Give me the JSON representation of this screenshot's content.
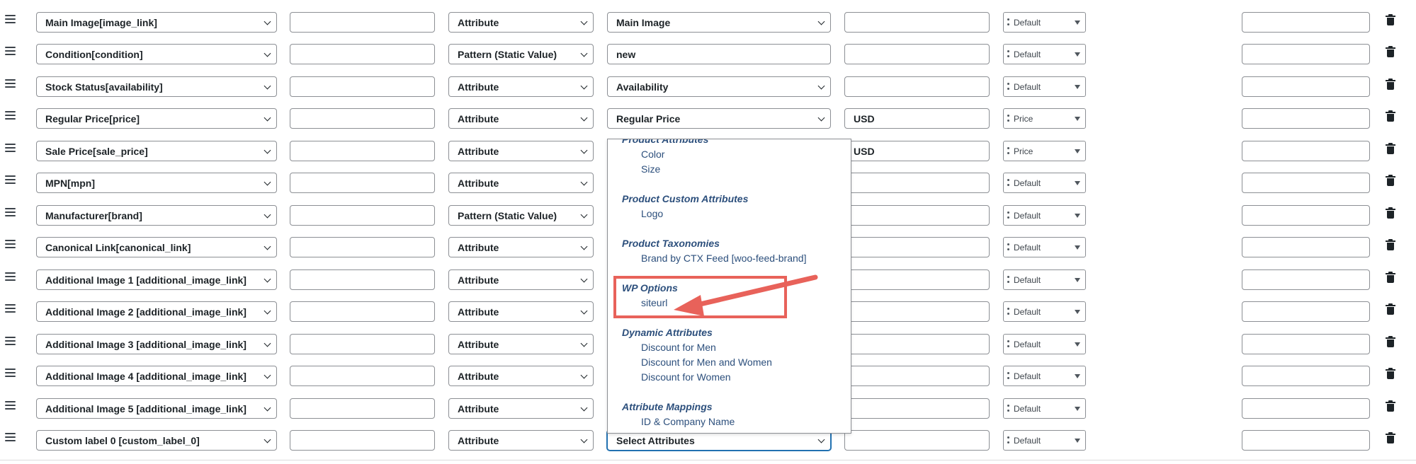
{
  "rows": [
    {
      "attribute": "Main Image[image_link]",
      "prefix": "",
      "type": "Attribute",
      "value": "Main Image",
      "suffix": "",
      "output": "Default",
      "limit": ""
    },
    {
      "attribute": "Condition[condition]",
      "prefix": "",
      "type": "Pattern (Static Value)",
      "value": "new",
      "suffix": "",
      "output": "Default",
      "limit": ""
    },
    {
      "attribute": "Stock Status[availability]",
      "prefix": "",
      "type": "Attribute",
      "value": "Availability",
      "suffix": "",
      "output": "Default",
      "limit": ""
    },
    {
      "attribute": "Regular Price[price]",
      "prefix": "",
      "type": "Attribute",
      "value": "Regular Price",
      "suffix": "USD",
      "output": "Price",
      "limit": ""
    },
    {
      "attribute": "Sale Price[sale_price]",
      "prefix": "",
      "type": "Attribute",
      "value": "",
      "suffix": "USD",
      "output": "Price",
      "limit": ""
    },
    {
      "attribute": "MPN[mpn]",
      "prefix": "",
      "type": "Attribute",
      "value": "",
      "suffix": "",
      "output": "Default",
      "limit": ""
    },
    {
      "attribute": "Manufacturer[brand]",
      "prefix": "",
      "type": "Pattern (Static Value)",
      "value": "",
      "suffix": "",
      "output": "Default",
      "limit": ""
    },
    {
      "attribute": "Canonical Link[canonical_link]",
      "prefix": "",
      "type": "Attribute",
      "value": "",
      "suffix": "",
      "output": "Default",
      "limit": ""
    },
    {
      "attribute": "Additional Image 1 [additional_image_link]",
      "prefix": "",
      "type": "Attribute",
      "value": "",
      "suffix": "",
      "output": "Default",
      "limit": ""
    },
    {
      "attribute": "Additional Image 2 [additional_image_link]",
      "prefix": "",
      "type": "Attribute",
      "value": "",
      "suffix": "",
      "output": "Default",
      "limit": ""
    },
    {
      "attribute": "Additional Image 3 [additional_image_link]",
      "prefix": "",
      "type": "Attribute",
      "value": "",
      "suffix": "",
      "output": "Default",
      "limit": ""
    },
    {
      "attribute": "Additional Image 4 [additional_image_link]",
      "prefix": "",
      "type": "Attribute",
      "value": "",
      "suffix": "",
      "output": "Default",
      "limit": ""
    },
    {
      "attribute": "Additional Image 5 [additional_image_link]",
      "prefix": "",
      "type": "Attribute",
      "value": "",
      "suffix": "",
      "output": "Default",
      "limit": ""
    },
    {
      "attribute": "Custom label 0 [custom_label_0]",
      "prefix": "",
      "type": "Attribute",
      "value": "Select Attributes",
      "suffix": "",
      "output": "Default",
      "limit": ""
    }
  ],
  "dropdown": {
    "groups": [
      {
        "title": "Product Attributes",
        "options": [
          "Color",
          "Size"
        ]
      },
      {
        "title": "Product Custom Attributes",
        "options": [
          "Logo"
        ]
      },
      {
        "title": "Product Taxonomies",
        "options": [
          "Brand by CTX Feed [woo-feed-brand]"
        ]
      },
      {
        "title": "WP Options",
        "options": [
          "siteurl"
        ]
      },
      {
        "title": "Dynamic Attributes",
        "options": [
          "Discount for Men",
          "Discount for Men and Women",
          "Discount for Women"
        ]
      },
      {
        "title": "Attribute Mappings",
        "options": [
          "ID & Company Name"
        ]
      }
    ]
  },
  "icons": {
    "drag": "drag-handle-icon",
    "chevron": "chevron-down-icon",
    "reorder": "reorder-dots-icon",
    "delete": "trash-icon"
  },
  "colors": {
    "highlight": "#e8625a",
    "group_text": "#2c4f7c",
    "focus": "#2271b1"
  }
}
